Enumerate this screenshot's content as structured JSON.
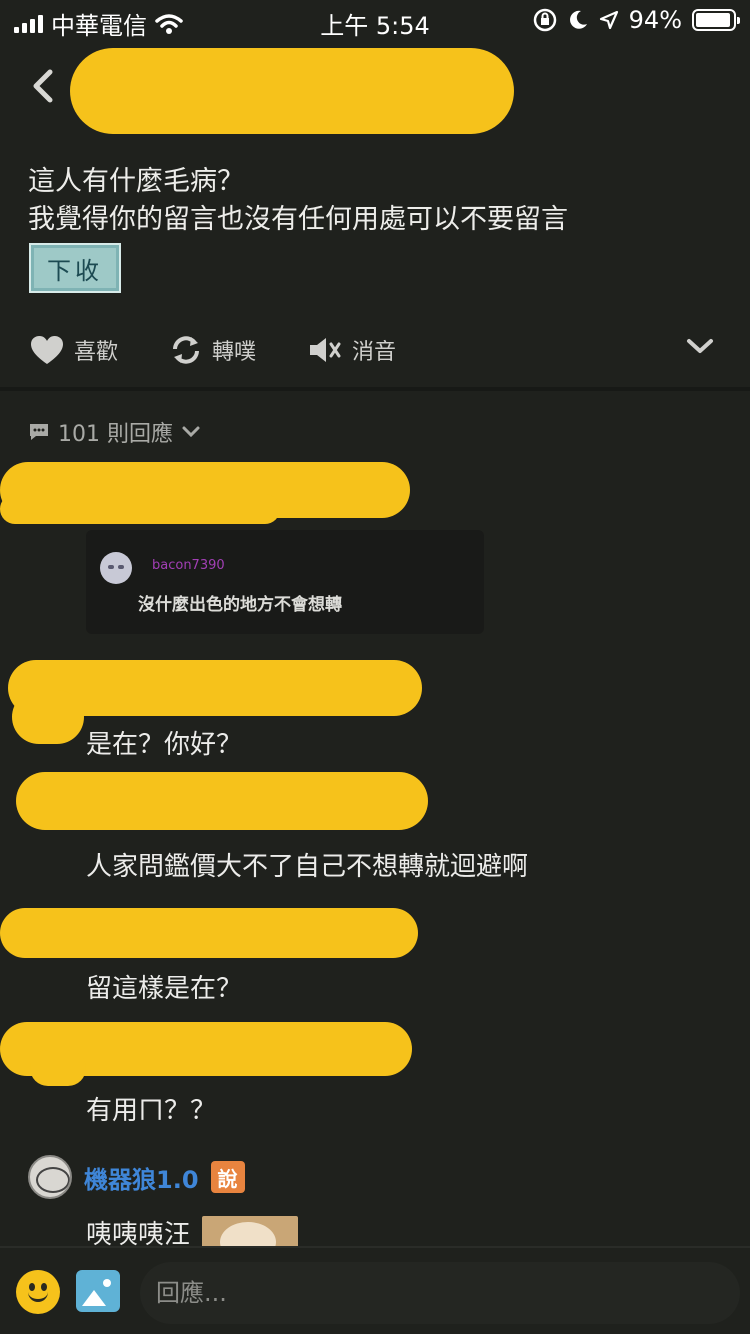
{
  "status_bar": {
    "carrier": "中華電信",
    "time": "上午 5:54",
    "battery": "94%",
    "battery_level": 0.94
  },
  "post": {
    "lines": [
      "這人有什麼毛病？",
      "我覺得你的留言也沒有任何用處可以不要留言"
    ],
    "sticker_text": "下收"
  },
  "actions": {
    "like": "喜歡",
    "repost": "轉噗",
    "mute": "消音"
  },
  "replies": {
    "count_label": "101 則回應"
  },
  "quoted": {
    "username": "bacon7390",
    "text": "沒什麼出色的地方不會想轉"
  },
  "comments": [
    {
      "text": "是在？你好？"
    },
    {
      "text": "人家問鑑價大不了自己不想轉就迴避啊"
    },
    {
      "text": "留這樣是在？"
    },
    {
      "text": "有用ㄇ？？"
    }
  ],
  "last_comment": {
    "user": "機器狼1.0",
    "badge": "說",
    "text": "咦咦咦汪"
  },
  "reply_box": {
    "placeholder": "回應..."
  }
}
